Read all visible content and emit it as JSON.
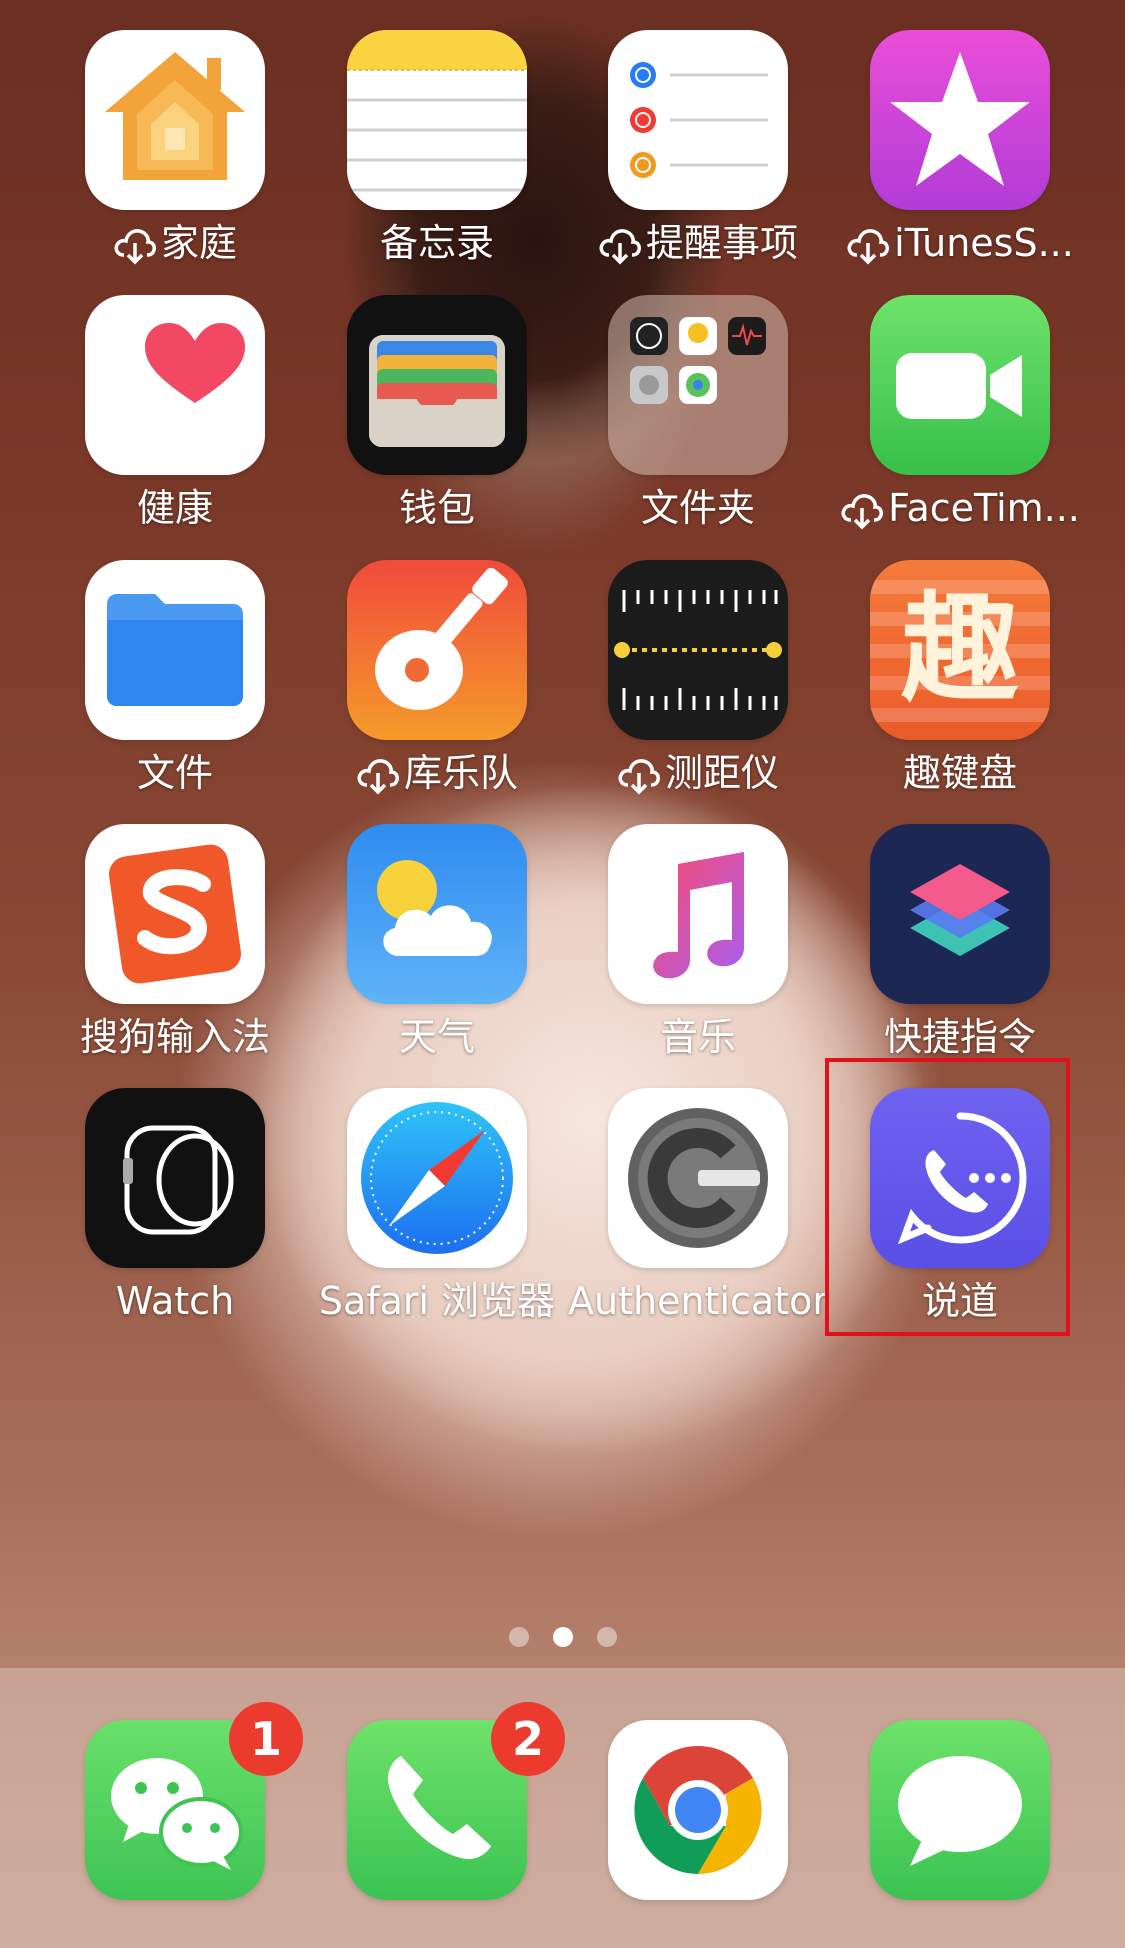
{
  "home_screen": {
    "apps": [
      {
        "label": "家庭",
        "icon": "home-icon",
        "downloading": true
      },
      {
        "label": "备忘录",
        "icon": "notes-icon",
        "downloading": false
      },
      {
        "label": "提醒事项",
        "icon": "reminders-icon",
        "downloading": true
      },
      {
        "label": "iTunesS...",
        "icon": "itunes-store-icon",
        "downloading": true
      },
      {
        "label": "健康",
        "icon": "health-icon",
        "downloading": false
      },
      {
        "label": "钱包",
        "icon": "wallet-icon",
        "downloading": false
      },
      {
        "label": "文件夹",
        "icon": "folder-icon",
        "downloading": false
      },
      {
        "label": "FaceTim...",
        "icon": "facetime-icon",
        "downloading": true
      },
      {
        "label": "文件",
        "icon": "files-icon",
        "downloading": false
      },
      {
        "label": "库乐队",
        "icon": "garageband-icon",
        "downloading": true
      },
      {
        "label": "测距仪",
        "icon": "measure-icon",
        "downloading": true
      },
      {
        "label": "趣键盘",
        "icon": "qu-keyboard-icon",
        "downloading": false,
        "glyph": "趣"
      },
      {
        "label": "搜狗输入法",
        "icon": "sogou-icon",
        "downloading": false
      },
      {
        "label": "天气",
        "icon": "weather-icon",
        "downloading": false
      },
      {
        "label": "音乐",
        "icon": "music-icon",
        "downloading": false
      },
      {
        "label": "快捷指令",
        "icon": "shortcuts-icon",
        "downloading": false
      },
      {
        "label": "Watch",
        "icon": "watch-icon",
        "downloading": false
      },
      {
        "label": "Safari 浏览器",
        "icon": "safari-icon",
        "downloading": false
      },
      {
        "label": "Authenticator",
        "icon": "authenticator-icon",
        "downloading": false
      },
      {
        "label": "说道",
        "icon": "shuodao-icon",
        "downloading": false
      }
    ],
    "page_indicator": {
      "count": 3,
      "active": 2
    }
  },
  "dock": {
    "apps": [
      {
        "name": "wechat",
        "icon": "wechat-icon",
        "badge": "1"
      },
      {
        "name": "phone",
        "icon": "phone-icon",
        "badge": "2"
      },
      {
        "name": "chrome",
        "icon": "chrome-icon",
        "badge": ""
      },
      {
        "name": "messages",
        "icon": "messages-icon",
        "badge": ""
      }
    ]
  },
  "colors": {
    "highlight": "#e0111a",
    "badge": "#eb3b2f"
  }
}
